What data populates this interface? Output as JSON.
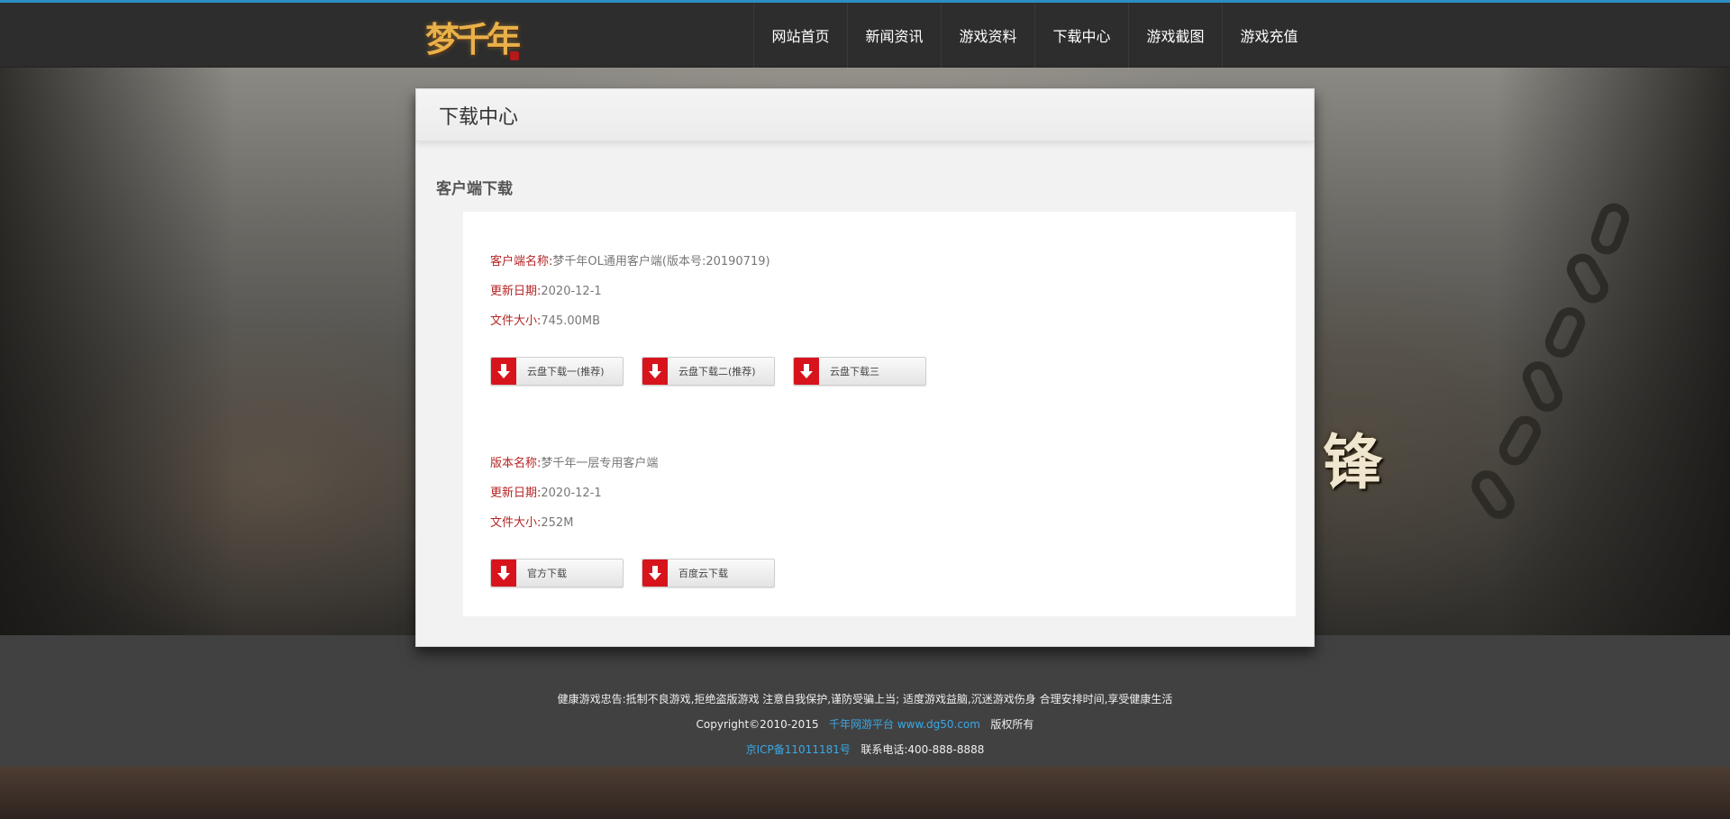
{
  "header": {
    "logo_text": "梦千年",
    "nav": [
      {
        "label": "网站首页"
      },
      {
        "label": "新闻资讯"
      },
      {
        "label": "游戏资料"
      },
      {
        "label": "下载中心"
      },
      {
        "label": "游戏截图"
      },
      {
        "label": "游戏充值"
      }
    ]
  },
  "background": {
    "slogan_fragment": "锋"
  },
  "panel": {
    "title": "下载中心",
    "section_title": "客户端下载",
    "clients": [
      {
        "name_label": "客户端名称:",
        "name_value": "梦千年OL通用客户端(版本号:20190719)",
        "date_label": "更新日期:",
        "date_value": "2020-12-1",
        "size_label": "文件大小:",
        "size_value": "745.00MB",
        "buttons": [
          "云盘下载一(推荐)",
          "云盘下载二(推荐)",
          "云盘下载三"
        ]
      },
      {
        "name_label": "版本名称:",
        "name_value": "梦千年一层专用客户端",
        "date_label": "更新日期:",
        "date_value": "2020-12-1",
        "size_label": "文件大小:",
        "size_value": "252M",
        "buttons": [
          "官方下载",
          "百度云下载"
        ]
      }
    ]
  },
  "footer": {
    "advisory": "健康游戏忠告:抵制不良游戏,拒绝盗版游戏 注意自我保护,谨防受骗上当; 适度游戏益脑,沉迷游戏伤身 合理安排时间,享受健康生活",
    "copyright_prefix": "Copyright©2010-2015",
    "platform_link": "千年网游平台 www.dg50.com",
    "rights": "版权所有",
    "icp_link": "京ICP备11011181号",
    "contact": "联系电话:400-888-8888"
  },
  "colors": {
    "accent_top": "#2a8fc2",
    "label_red": "#b52424",
    "download_red": "#d7141c",
    "link_blue": "#3aa8e6"
  }
}
